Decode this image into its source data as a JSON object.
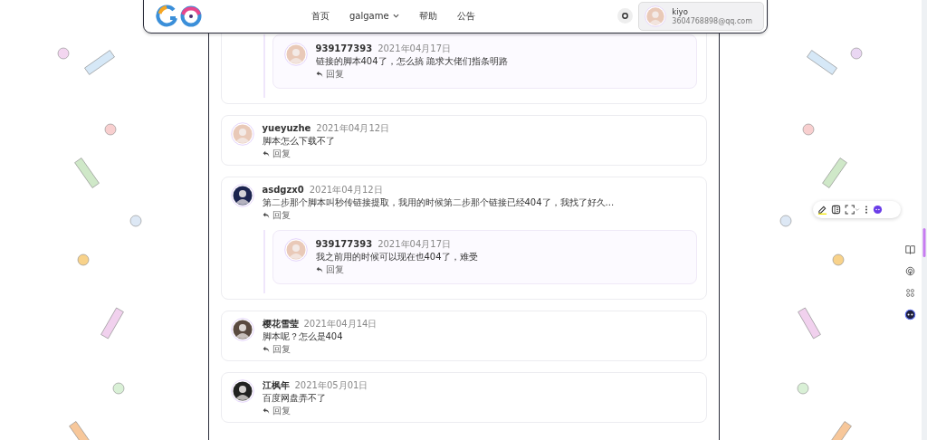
{
  "header": {
    "nav": [
      {
        "label": "首页",
        "dropdown": false
      },
      {
        "label": "galgame",
        "dropdown": true
      },
      {
        "label": "帮助",
        "dropdown": false
      },
      {
        "label": "公告",
        "dropdown": false
      }
    ],
    "user": {
      "name": "kiyo",
      "email": "3604768898@qq.com"
    }
  },
  "comments": [
    {
      "replies": [
        {
          "author": "939177393",
          "date": "2021年04月17日",
          "text": "链接的脚本404了，怎么搞 跪求大佬们指条明路",
          "reply_label": "回复"
        }
      ]
    },
    {
      "author": "yueyuzhe",
      "date": "2021年04月12日",
      "text": "脚本怎么下载不了",
      "reply_label": "回复"
    },
    {
      "author": "asdgzx0",
      "date": "2021年04月12日",
      "text": "第二步那个脚本叫秒传链接提取，我用的时候第二步那个链接已经404了，我找了好久...",
      "reply_label": "回复",
      "replies": [
        {
          "author": "939177393",
          "date": "2021年04月17日",
          "text": "我之前用的时候可以现在也404了，难受",
          "reply_label": "回复"
        }
      ]
    },
    {
      "author": "樱花雪莹",
      "date": "2021年04月14日",
      "text": "脚本呢？怎么是404",
      "reply_label": "回复"
    },
    {
      "author": "江枫年",
      "date": "2021年05月01日",
      "text": "百度网盘弄不了",
      "reply_label": "回复"
    }
  ]
}
